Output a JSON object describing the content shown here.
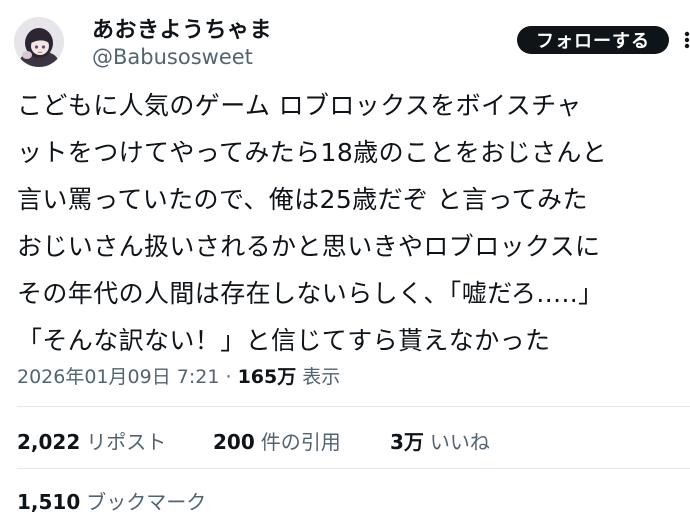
{
  "author": {
    "display_name": "あおきようちゃま",
    "handle": "@Babusosweet"
  },
  "follow_button": {
    "label": "フォローする"
  },
  "more_icon": "more-vertical-icon",
  "tweet": {
    "lines": [
      "こどもに人気のゲーム ロブロックスをボイスチャ",
      "ットをつけてやってみたら18歳のことをおじさんと",
      "言い罵っていたので、俺は25歳だぞ と言ってみた",
      "おじいさん扱いされるかと思いきやロブロックスに",
      "その年代の人間は存在しないらしく、「嘘だろ.....」",
      "「そんな訳ない！」と信じてすら貰えなかった"
    ]
  },
  "meta": {
    "timestamp": "2026年01月09日 7:21",
    "separator": "·",
    "views_count": "165万",
    "views_label": "表示"
  },
  "stats": {
    "reposts": {
      "count": "2,022",
      "label": "リポスト"
    },
    "quotes": {
      "count": "200",
      "label": "件の引用"
    },
    "likes": {
      "count": "3万",
      "label": "いいね"
    },
    "bookmarks": {
      "count": "1,510",
      "label": "ブックマーク"
    }
  },
  "colors": {
    "text": "#0f1419",
    "secondary": "#536471",
    "divider": "#e3e7ea",
    "button_bg": "#0f1419"
  }
}
